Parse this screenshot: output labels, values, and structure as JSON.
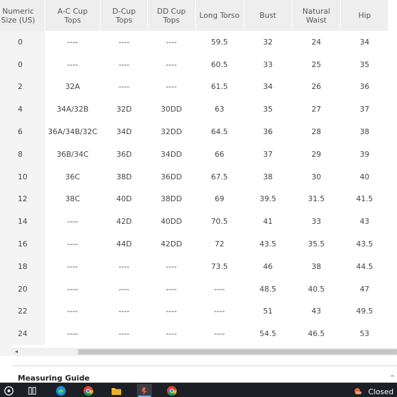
{
  "table": {
    "headers": [
      [
        "Numeric",
        "Size (US)"
      ],
      [
        "A-C Cup",
        "Tops"
      ],
      [
        "D-Cup",
        "Tops"
      ],
      [
        "DD Cup",
        "Tops"
      ],
      [
        "Long Torso"
      ],
      [
        "Bust"
      ],
      [
        "Natural",
        "Waist"
      ],
      [
        "Hip"
      ]
    ],
    "rows": [
      [
        "0",
        "----",
        "----",
        "----",
        "59.5",
        "32",
        "24",
        "34"
      ],
      [
        "0",
        "----",
        "----",
        "----",
        "60.5",
        "33",
        "25",
        "35"
      ],
      [
        "2",
        "32A",
        "----",
        "----",
        "61.5",
        "34",
        "26",
        "36"
      ],
      [
        "4",
        "34A/32B",
        "32D",
        "30DD",
        "63",
        "35",
        "27",
        "37"
      ],
      [
        "6",
        "36A/34B/32C",
        "34D",
        "32DD",
        "64.5",
        "36",
        "28",
        "38"
      ],
      [
        "8",
        "36B/34C",
        "36D",
        "34DD",
        "66",
        "37",
        "29",
        "39"
      ],
      [
        "10",
        "36C",
        "38D",
        "36DD",
        "67.5",
        "38",
        "30",
        "40"
      ],
      [
        "12",
        "38C",
        "40D",
        "38DD",
        "69",
        "39.5",
        "31.5",
        "41.5"
      ],
      [
        "14",
        "----",
        "42D",
        "40DD",
        "70.5",
        "41",
        "33",
        "43"
      ],
      [
        "16",
        "----",
        "44D",
        "42DD",
        "72",
        "43.5",
        "35.5",
        "43.5"
      ],
      [
        "18",
        "----",
        "----",
        "----",
        "73.5",
        "46",
        "38",
        "44.5"
      ],
      [
        "20",
        "----",
        "----",
        "----",
        "----",
        "48.5",
        "40.5",
        "47"
      ],
      [
        "22",
        "----",
        "----",
        "----",
        "----",
        "51",
        "43",
        "49.5"
      ],
      [
        "24",
        "----",
        "----",
        "----",
        "----",
        "54.5",
        "46.5",
        "53"
      ]
    ]
  },
  "scrollbar": {
    "left_arrow": "◂"
  },
  "section": {
    "title": "Measuring Guide"
  },
  "taskbar": {
    "icons": [
      "windows-start-icon",
      "task-view-icon",
      "edge-icon",
      "chrome-icon",
      "file-explorer-icon",
      "app-icon",
      "chrome-icon",
      "weather-icon"
    ],
    "weather_text": "Closed"
  },
  "colors": {
    "header_bg": "#eeeeee",
    "first_col_bg": "#f4f4f4",
    "taskbar_bg": "#1d1f26",
    "edge_blue": "#1f8fd6",
    "chrome_red": "#db4437",
    "chrome_yellow": "#f4b400",
    "chrome_green": "#0f9d58"
  }
}
